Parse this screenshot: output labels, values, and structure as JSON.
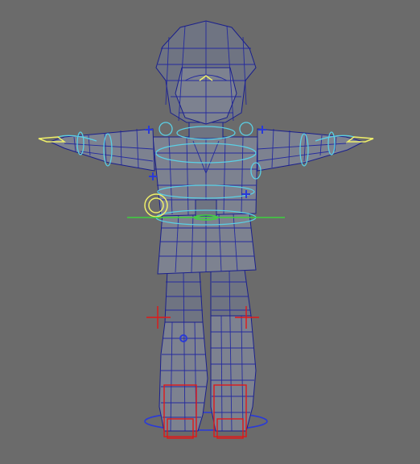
{
  "viewport": {
    "background": "#6b6b6b",
    "mesh_fill": "#7d8290",
    "wire_color": "#1a1f8c",
    "controls": {
      "ik_fk": "#5ad0e6",
      "root_cog": "#f0f06a",
      "hip_ground": "#3ed13e",
      "pole_vector": "#e11818",
      "joint_markers": "#2a3ad8"
    }
  },
  "icons": [
    "character-mesh-icon",
    "pole-vector-cross-icon",
    "joint-marker-icon"
  ]
}
